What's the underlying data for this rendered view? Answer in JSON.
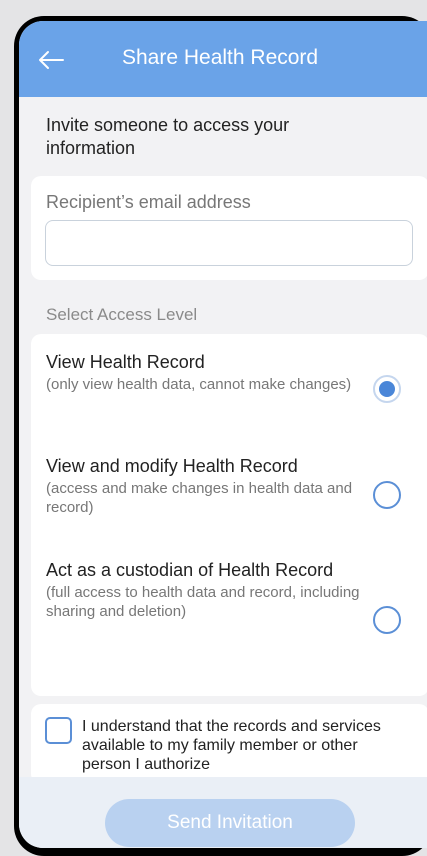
{
  "header": {
    "title": "Share Health Record",
    "back_icon": "arrow-left-icon",
    "background": "#6aa3e8"
  },
  "intro": "Invite someone to access your information",
  "email": {
    "label": "Recipient’s email address",
    "value": "",
    "placeholder": ""
  },
  "access": {
    "section_label": "Select Access Level",
    "selected": 0,
    "options": [
      {
        "title": "View Health Record",
        "description": "(only view health data, cannot make changes)"
      },
      {
        "title": "View and modify Health Record",
        "description": "(access and make changes in health data and record)"
      },
      {
        "title": "Act as a custodian of Health Record",
        "description": "(full access to health data and record, including sharing and deletion)"
      }
    ]
  },
  "consent": {
    "checked": false,
    "text": "I understand that the records and services available to my family member or other person I authorize"
  },
  "footer": {
    "send_label": "Send Invitation",
    "send_enabled": false
  },
  "colors": {
    "accent": "#4a86d8",
    "button_disabled": "#b9d1f0"
  }
}
